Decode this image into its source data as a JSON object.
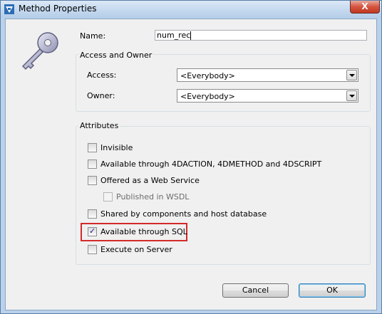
{
  "window": {
    "title": "Method Properties",
    "close_label": "X"
  },
  "name": {
    "label": "Name:",
    "value": "num_rec"
  },
  "access_owner": {
    "title": "Access and Owner",
    "access_label": "Access:",
    "access_value": "<Everybody>",
    "owner_label": "Owner:",
    "owner_value": "<Everybody>"
  },
  "attributes": {
    "title": "Attributes",
    "items": [
      {
        "label": "Invisible",
        "checked": false,
        "enabled": true
      },
      {
        "label": "Available through 4DACTION, 4DMETHOD and 4DSCRIPT",
        "checked": false,
        "enabled": true
      },
      {
        "label": "Offered as a Web Service",
        "checked": false,
        "enabled": true
      },
      {
        "label": "Published in WSDL",
        "checked": false,
        "enabled": false
      },
      {
        "label": "Shared by components and host database",
        "checked": false,
        "enabled": true
      },
      {
        "label": "Available through SQL",
        "checked": true,
        "enabled": true
      },
      {
        "label": "Execute on Server",
        "checked": false,
        "enabled": true
      }
    ]
  },
  "buttons": {
    "cancel": "Cancel",
    "ok": "OK"
  },
  "colors": {
    "highlight": "#d42a2a",
    "titlebar": "#c5d9ef",
    "dialog_bg": "#f0f0f0"
  }
}
